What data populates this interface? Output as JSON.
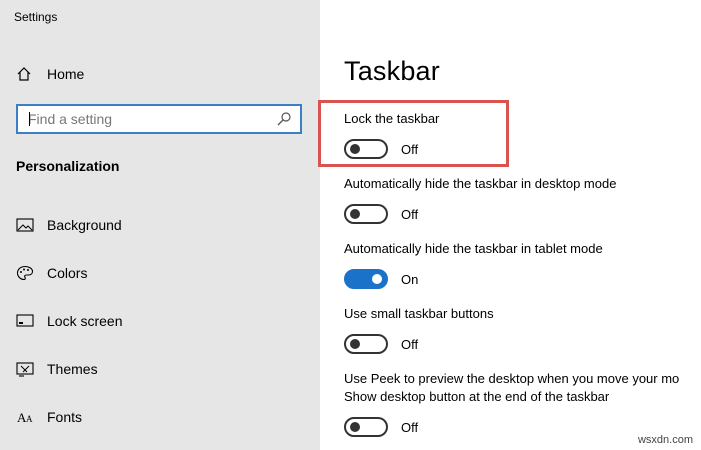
{
  "window": {
    "title": "Settings"
  },
  "sidebar": {
    "home_label": "Home",
    "search": {
      "placeholder": "Find a setting",
      "value": ""
    },
    "section_heading": "Personalization",
    "items": [
      {
        "label": "Background",
        "icon": "background-image-icon"
      },
      {
        "label": "Colors",
        "icon": "palette-icon"
      },
      {
        "label": "Lock screen",
        "icon": "lock-screen-icon"
      },
      {
        "label": "Themes",
        "icon": "themes-icon"
      },
      {
        "label": "Fonts",
        "icon": "fonts-icon"
      }
    ]
  },
  "main": {
    "title": "Taskbar",
    "settings": [
      {
        "label": "Lock the taskbar",
        "state": "Off",
        "on": false,
        "highlighted": true
      },
      {
        "label": "Automatically hide the taskbar in desktop mode",
        "state": "Off",
        "on": false
      },
      {
        "label": "Automatically hide the taskbar in tablet mode",
        "state": "On",
        "on": true
      },
      {
        "label": "Use small taskbar buttons",
        "state": "Off",
        "on": false
      },
      {
        "label_line1": "Use Peek to preview the desktop when you move your mo",
        "label_line2": "Show desktop button at the end of the taskbar",
        "state": "Off",
        "on": false
      }
    ]
  },
  "colors": {
    "accent": "#1a73c8",
    "highlight_border": "#d9534f",
    "search_border": "#3b7fc7"
  },
  "watermark": "wsxdn.com"
}
